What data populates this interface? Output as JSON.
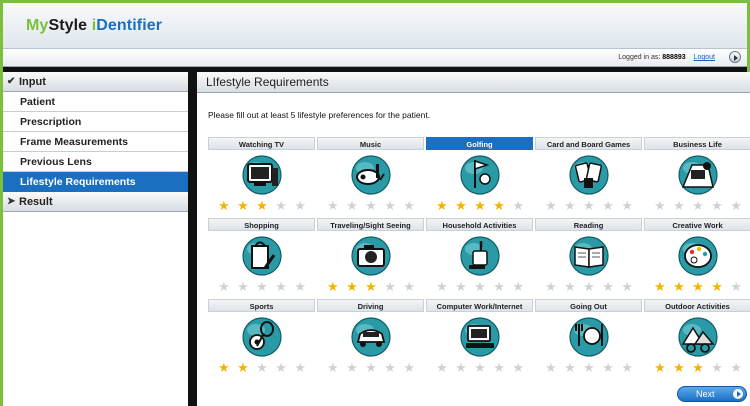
{
  "app": {
    "logo_my": "My",
    "logo_style": "Style",
    "logo_ident_i": "i",
    "logo_ident_rest": "Dentifier"
  },
  "login": {
    "prefix": "Logged in as:",
    "user": "888893",
    "logout_label": "Logout"
  },
  "sidebar": {
    "input_label": "Input",
    "items": [
      {
        "label": "Patient",
        "active": false
      },
      {
        "label": "Prescription",
        "active": false
      },
      {
        "label": "Frame Measurements",
        "active": false
      },
      {
        "label": "Previous Lens",
        "active": false
      },
      {
        "label": "Lifestyle Requirements",
        "active": true
      }
    ],
    "result_label": "Result"
  },
  "main": {
    "title": "LIfestyle Requirements",
    "instructions": "Please fill out at least 5 lifestyle preferences for the patient.",
    "next_label": "Next",
    "star_color_on": "#f2b400",
    "star_color_off": "#cfd2d5",
    "accent": "#1b6fc0",
    "max_stars": 5,
    "categories": [
      {
        "label": "Watching TV",
        "icon": "tv-icon",
        "rating": 3,
        "active": false
      },
      {
        "label": "Music",
        "icon": "music-icon",
        "rating": 0,
        "active": false
      },
      {
        "label": "Golfing",
        "icon": "golf-icon",
        "rating": 4,
        "active": true
      },
      {
        "label": "Card and Board Games",
        "icon": "cards-icon",
        "rating": 0,
        "active": false
      },
      {
        "label": "Business Life",
        "icon": "business-icon",
        "rating": 0,
        "active": false
      },
      {
        "label": "Shopping",
        "icon": "shopping-icon",
        "rating": 0,
        "active": false
      },
      {
        "label": "Traveling/Sight Seeing",
        "icon": "camera-icon",
        "rating": 3,
        "active": false
      },
      {
        "label": "Household Activities",
        "icon": "vacuum-icon",
        "rating": 0,
        "active": false
      },
      {
        "label": "Reading",
        "icon": "book-icon",
        "rating": 0,
        "active": false
      },
      {
        "label": "Creative Work",
        "icon": "palette-icon",
        "rating": 4,
        "active": false
      },
      {
        "label": "Sports",
        "icon": "sports-icon",
        "rating": 2,
        "active": false
      },
      {
        "label": "Driving",
        "icon": "car-icon",
        "rating": 0,
        "active": false
      },
      {
        "label": "Computer Work/Internet",
        "icon": "computer-icon",
        "rating": 0,
        "active": false
      },
      {
        "label": "Going Out",
        "icon": "dining-icon",
        "rating": 0,
        "active": false
      },
      {
        "label": "Outdoor Activities",
        "icon": "outdoor-icon",
        "rating": 3,
        "active": false
      }
    ]
  }
}
